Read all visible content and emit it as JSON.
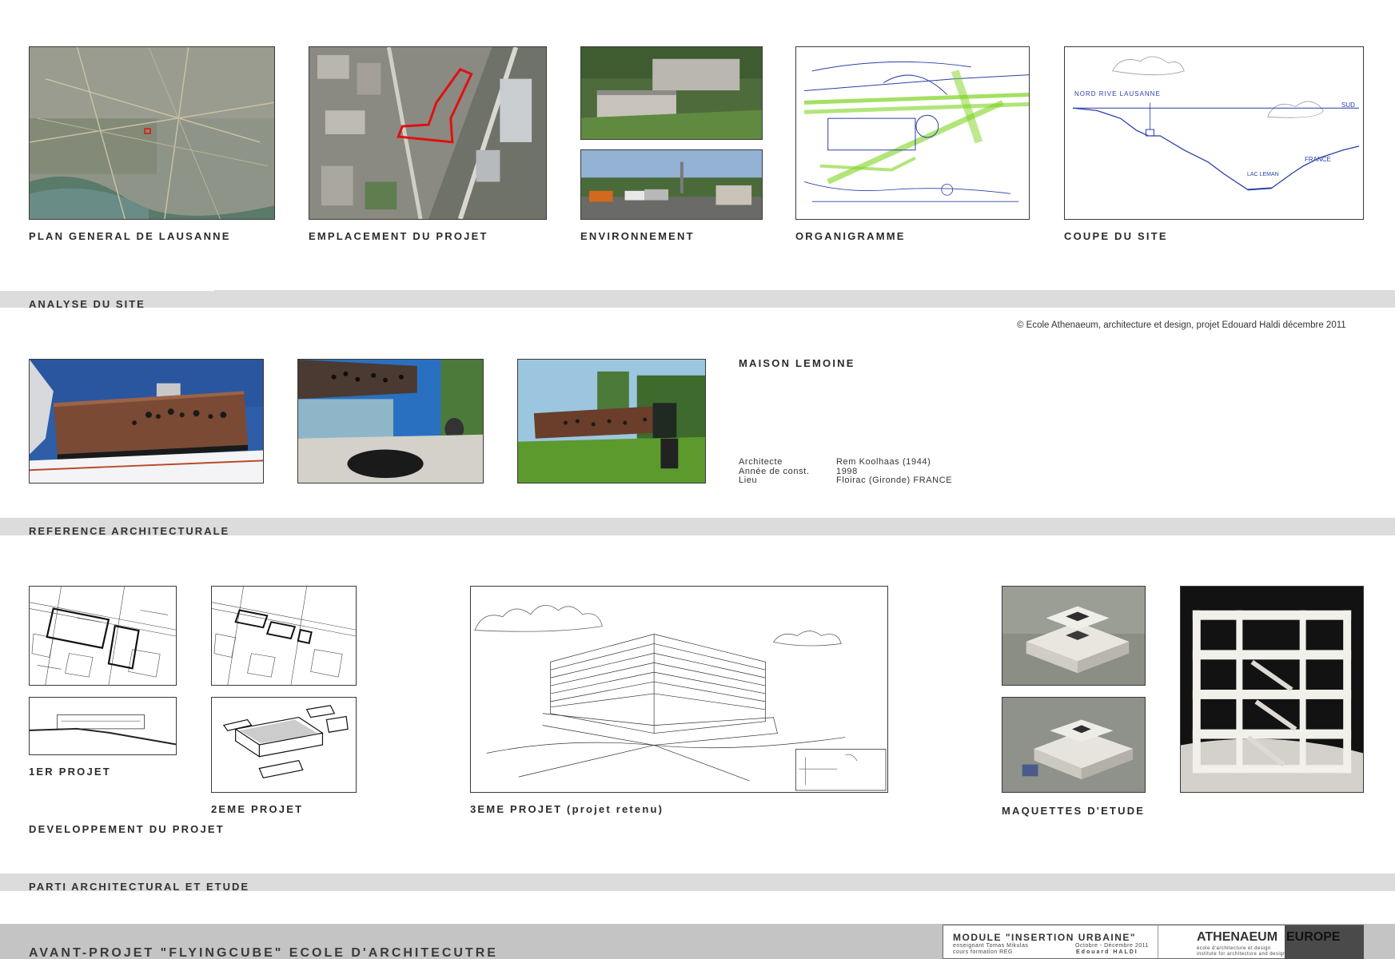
{
  "row1": {
    "captions": [
      "PLAN GENERAL DE LAUSANNE",
      "EMPLACEMENT DU PROJET",
      "ENVIRONNEMENT",
      "ORGANIGRAMME",
      "COUPE DU SITE"
    ],
    "band_label": "ANALYSE DU SITE"
  },
  "copyright": "© Ecole Athenaeum, architecture et design, projet Edouard Haldi décembre 2011",
  "reference": {
    "title": "MAISON LEMOINE",
    "rows": [
      {
        "key": "Architecte",
        "value": "Rem Koolhaas (1944)"
      },
      {
        "key": "Année de const.",
        "value": "1998"
      },
      {
        "key": "Lieu",
        "value": "Floirac (Gironde) FRANCE"
      }
    ],
    "band_label": "REFERENCE ARCHITECTURALE"
  },
  "parti": {
    "captions": {
      "p1": "1ER PROJET",
      "p2": "2EME PROJET",
      "p3": "3EME PROJET (projet retenu)",
      "maquettes": "MAQUETTES D'ETUDE",
      "developpement": "DEVELOPPEMENT DU PROJET"
    },
    "band_label": "PARTI ARCHITECTURAL ET ETUDE"
  },
  "footer": {
    "title": "AVANT-PROJET \"FLYINGCUBE\" ECOLE D'ARCHITECUTRE",
    "module_title": "MODULE \"INSERTION URBAINE\"",
    "teacher": "enseignant Tomas Mikulas",
    "course": "cours formation REG",
    "dates": "Octobre - Décembre 2011",
    "author": "Edouard HALDI",
    "logo_main": "ATHENAEUM",
    "logo_box": "EUROPE",
    "logo_sub1": "école d'architecture et design",
    "logo_sub2": "institute for architecture and design"
  },
  "sketch_labels": {
    "coupe_left": "NORD  RIVE  LAUSANNE",
    "coupe_right": "SUD",
    "coupe_mid": "FRANCE",
    "coupe_lac": "LAC LEMAN"
  },
  "colors": {
    "band": "#dcdcdc",
    "footer": "#c4c4c4",
    "red_outline": "#e01010",
    "sketch_blue": "#2a3fa8",
    "sketch_green": "#7ed321"
  }
}
